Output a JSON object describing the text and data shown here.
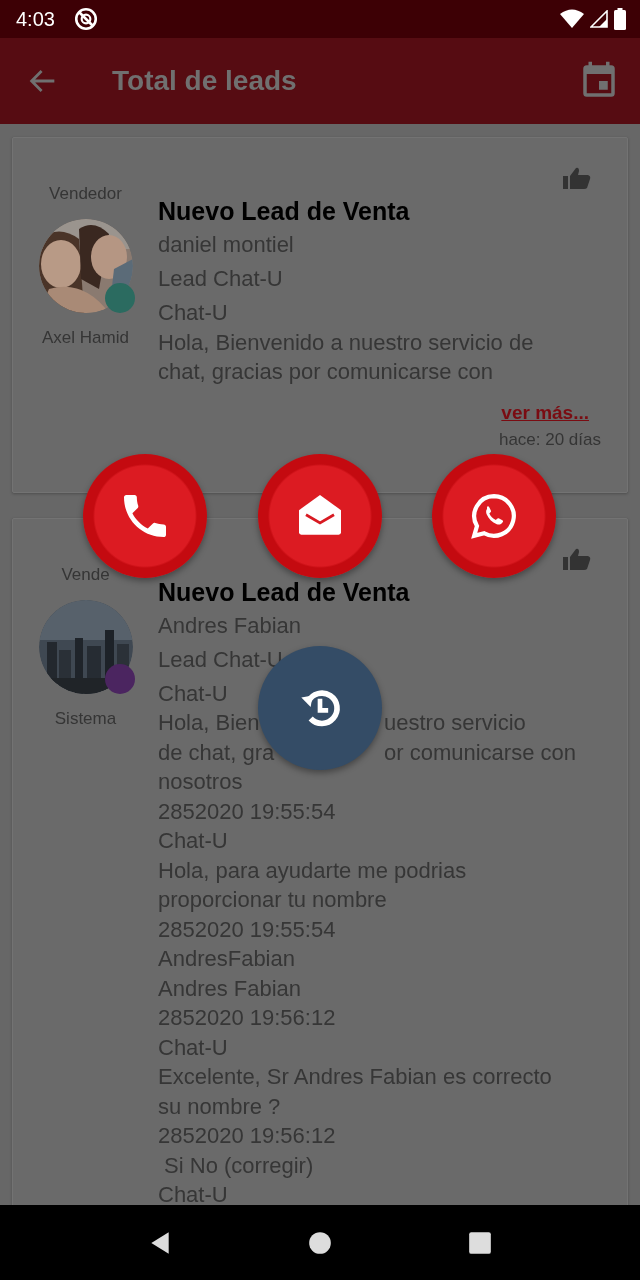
{
  "status_bar": {
    "time": "4:03"
  },
  "app_bar": {
    "title": "Total de leads"
  },
  "leads": [
    {
      "role_label": "Vendedor",
      "seller": "Axel Hamid",
      "color": "#2b6b60",
      "title": "Nuevo Lead de Venta",
      "contact": "daniel montiel",
      "source": "Lead Chat-U",
      "body_lines": [
        "Chat-U",
        "Hola, Bienvenido a nuestro servicio de",
        "chat, gracias por comunicarse con"
      ],
      "more_link": "ver más...",
      "age": "hace: 20 días"
    },
    {
      "role_label": "Vende",
      "seller": "Sistema",
      "color": "#4b2560",
      "title": "Nuevo Lead de Venta",
      "contact": "Andres Fabian",
      "source": "Lead Chat-U",
      "body_lines": [
        "Chat-U",
        [
          "Hola, Bien",
          "uestro servicio"
        ],
        [
          "de chat, gra",
          "or comunicarse con"
        ],
        "nosotros",
        "2852020 19:55:54",
        "Chat-U",
        "Hola, para ayudarte me podrias",
        "proporcionar tu nombre",
        "2852020 19:55:54",
        "AndresFabian",
        "Andres Fabian",
        "2852020 19:56:12",
        "Chat-U",
        "Excelente, Sr Andres Fabian es correcto",
        "su nombre ?",
        "2852020 19:56:12",
        " Si No (corregir)",
        "Chat-U"
      ]
    }
  ],
  "actions": [
    {
      "kind": "phone"
    },
    {
      "kind": "mail"
    },
    {
      "kind": "whatsapp"
    },
    {
      "kind": "history"
    }
  ]
}
